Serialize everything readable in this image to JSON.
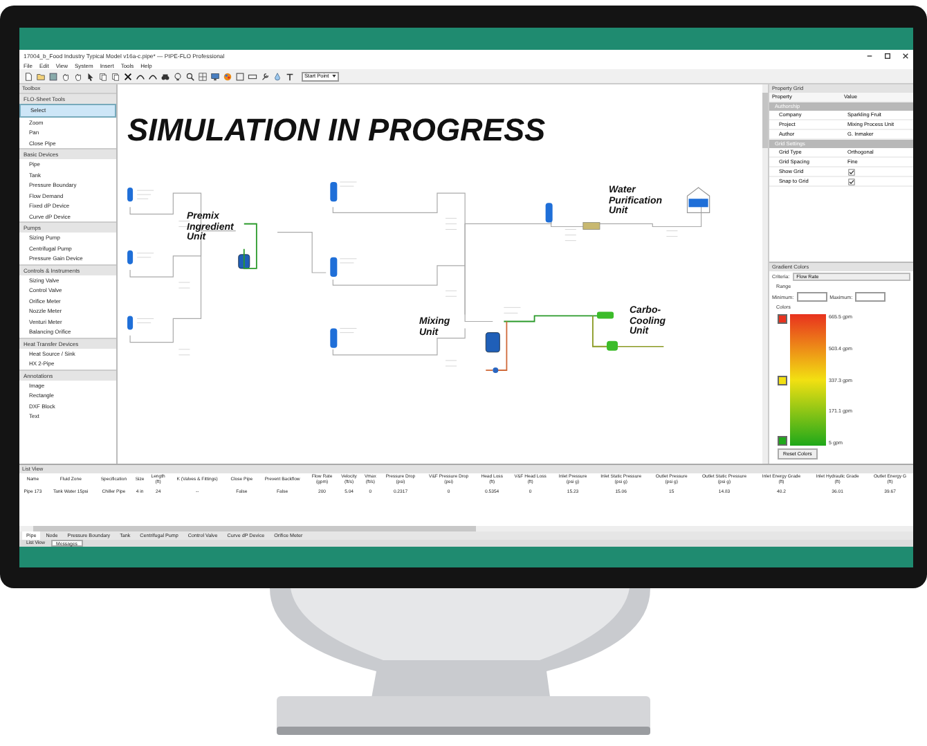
{
  "window": {
    "title": "17004_b_Food Industry Typical Model v16a-c.pipe* — PIPE-FLO Professional"
  },
  "menu": [
    "File",
    "Edit",
    "View",
    "System",
    "Insert",
    "Tools",
    "Help"
  ],
  "toolbar": {
    "dropdown": "Start Point"
  },
  "toolbox": {
    "title": "Toolbox",
    "groups": [
      {
        "label": "FLO-Sheet Tools",
        "items": [
          {
            "label": "Select",
            "selected": true
          },
          {
            "label": "Zoom",
            "selected": false
          },
          {
            "label": "Pan",
            "selected": false
          },
          {
            "label": "Close Pipe",
            "selected": false
          }
        ]
      },
      {
        "label": "Basic Devices",
        "items": [
          {
            "label": "Pipe",
            "selected": false
          },
          {
            "label": "Tank",
            "selected": false
          },
          {
            "label": "Pressure Boundary",
            "selected": false
          },
          {
            "label": "Flow Demand",
            "selected": false
          },
          {
            "label": "Fixed dP Device",
            "selected": false
          },
          {
            "label": "Curve dP Device",
            "selected": false
          }
        ]
      },
      {
        "label": "Pumps",
        "items": [
          {
            "label": "Sizing Pump",
            "selected": false
          },
          {
            "label": "Centrifugal Pump",
            "selected": false
          },
          {
            "label": "Pressure Gain Device",
            "selected": false
          }
        ]
      },
      {
        "label": "Controls & Instruments",
        "items": [
          {
            "label": "Sizing Valve",
            "selected": false
          },
          {
            "label": "Control Valve",
            "selected": false
          },
          {
            "label": "Orifice Meter",
            "selected": false
          },
          {
            "label": "Nozzle Meter",
            "selected": false
          },
          {
            "label": "Venturi Meter",
            "selected": false
          },
          {
            "label": "Balancing Orifice",
            "selected": false
          }
        ]
      },
      {
        "label": "Heat Transfer Devices",
        "items": [
          {
            "label": "Heat Source / Sink",
            "selected": false
          },
          {
            "label": "HX 2-Pipe",
            "selected": false
          }
        ]
      },
      {
        "label": "Annotations",
        "items": [
          {
            "label": "Image",
            "selected": false
          },
          {
            "label": "Rectangle",
            "selected": false
          },
          {
            "label": "DXF Block",
            "selected": false
          },
          {
            "label": "Text",
            "selected": false
          }
        ]
      }
    ]
  },
  "canvas": {
    "banner": "SIMULATION IN PROGRESS",
    "units": [
      "Premix Ingredient Unit",
      "Water Purification Unit",
      "Mixing Unit",
      "Carbo-Cooling Unit"
    ]
  },
  "property_grid": {
    "title": "Property Grid",
    "columns": [
      "Property",
      "Value"
    ],
    "groups": [
      {
        "label": "Authorship",
        "rows": [
          {
            "kind": "text",
            "name": "Company",
            "value": "Sparkling Fruit"
          },
          {
            "kind": "text",
            "name": "Project",
            "value": "Mixing Process Unit"
          },
          {
            "kind": "text",
            "name": "Author",
            "value": "G. Inmaker"
          }
        ]
      },
      {
        "label": "Grid Settings",
        "rows": [
          {
            "kind": "text",
            "name": "Grid Type",
            "value": "Orthogonal"
          },
          {
            "kind": "text",
            "name": "Grid Spacing",
            "value": "Fine"
          },
          {
            "kind": "check",
            "name": "Show Grid",
            "checked": true
          },
          {
            "kind": "check",
            "name": "Snap to Grid",
            "checked": true
          }
        ]
      }
    ]
  },
  "gradient": {
    "title": "Gradient Colors",
    "criteria_label": "Criteria:",
    "criteria": "Flow Rate",
    "range_label": "Range",
    "minimum_label": "Minimum:",
    "maximum_label": "Maximum:",
    "colors_label": "Colors",
    "stops": [
      {
        "color": "#e8321e"
      },
      {
        "color": "#f2e012"
      },
      {
        "color": "#1fa81a"
      }
    ],
    "scale": [
      "665.5 gpm",
      "503.4 gpm",
      "337.3 gpm",
      "171.1 gpm",
      "5 gpm"
    ],
    "reset": "Reset Colors"
  },
  "list_view": {
    "title": "List View",
    "columns": [
      {
        "label": "Name"
      },
      {
        "label": "Fluid Zone"
      },
      {
        "label": "Specification"
      },
      {
        "label": "Size"
      },
      {
        "label": "Length",
        "unit": "(ft)"
      },
      {
        "label": "K (Valves & Fittings)"
      },
      {
        "label": "Close Pipe"
      },
      {
        "label": "Prevent Backflow"
      },
      {
        "label": "Flow Rate",
        "unit": "(gpm)"
      },
      {
        "label": "Velocity",
        "unit": "(ft/s)"
      },
      {
        "label": "Vmax",
        "unit": "(ft/s)"
      },
      {
        "label": "Pressure Drop",
        "unit": "(psi)"
      },
      {
        "label": "V&F Pressure Drop",
        "unit": "(psi)"
      },
      {
        "label": "Head Loss",
        "unit": "(ft)"
      },
      {
        "label": "V&F Head Loss",
        "unit": "(ft)"
      },
      {
        "label": "Inlet Pressure",
        "unit": "(psi g)"
      },
      {
        "label": "Inlet Static Pressure",
        "unit": "(psi g)"
      },
      {
        "label": "Outlet Pressure",
        "unit": "(psi g)"
      },
      {
        "label": "Outlet Static Pressure",
        "unit": "(psi g)"
      },
      {
        "label": "Inlet Energy Grade",
        "unit": "(ft)"
      },
      {
        "label": "Inlet Hydraulic Grade",
        "unit": "(ft)"
      },
      {
        "label": "Outlet Energy G",
        "unit": "(ft)"
      }
    ],
    "rows": [
      [
        "Pipe 173",
        "Tank Water 15psi",
        "Chiller Pipe",
        "4 in",
        "24",
        "--",
        "False",
        "False",
        "200",
        "5.04",
        "0",
        "0.2317",
        "0",
        "0.5354",
        "0",
        "15.23",
        "15.06",
        "15",
        "14.83",
        "40.2",
        "36.01",
        "39.67"
      ]
    ]
  },
  "device_tabs": [
    {
      "label": "Pipe",
      "selected": true
    },
    {
      "label": "Node",
      "selected": false
    },
    {
      "label": "Pressure Boundary",
      "selected": false
    },
    {
      "label": "Tank",
      "selected": false
    },
    {
      "label": "Centrifugal Pump",
      "selected": false
    },
    {
      "label": "Control Valve",
      "selected": false
    },
    {
      "label": "Curve dP Device",
      "selected": false
    },
    {
      "label": "Orifice Meter",
      "selected": false
    }
  ],
  "panel_tabs": [
    {
      "label": "List View",
      "selected": false
    },
    {
      "label": "Messages",
      "selected": true
    }
  ]
}
